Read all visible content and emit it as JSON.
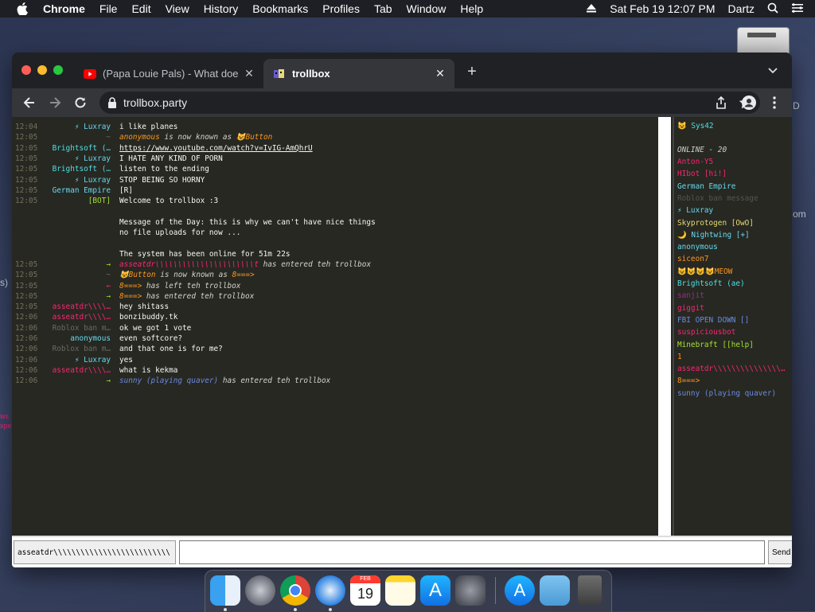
{
  "menubar": {
    "app": "Chrome",
    "items": [
      "File",
      "Edit",
      "View",
      "History",
      "Bookmarks",
      "Profiles",
      "Tab",
      "Window",
      "Help"
    ],
    "datetime": "Sat Feb 19  12:07 PM",
    "user": "Dartz"
  },
  "desktop": {
    "fragments": [
      "D",
      "om",
      "s)",
      "ws",
      "xpe"
    ]
  },
  "browser": {
    "tabs": [
      {
        "title": "(Papa Louie Pals) - What does",
        "icon": "youtube-icon"
      },
      {
        "title": "trollbox",
        "icon": "trollbox-icon"
      }
    ],
    "url": "trollbox.party"
  },
  "colors": {
    "bg": "#272822",
    "time": "#75715e",
    "blue": "#66d9ef",
    "cyan": "#4fdfe3",
    "orange": "#fd971f",
    "red": "#f92672",
    "green": "#a6e22e",
    "yellow": "#e6db74",
    "lightblue": "#6b8ae0"
  },
  "chat": [
    {
      "t": "12:04",
      "n": "⚡ Luxray",
      "nc": "#66d9ef",
      "m": "i like planes"
    },
    {
      "t": "12:05",
      "n": "~",
      "nc": "#75715e",
      "m": "anonymous",
      "mc": "#fd971f",
      "s": " is now known as ",
      "m2": "😺Button",
      "m2c": "#fd971f"
    },
    {
      "t": "12:05",
      "n": "Brightsoft (…",
      "nc": "#4fdfe3",
      "m": "https://www.youtube.com/watch?v=IvIG-AmQhrU",
      "u": true
    },
    {
      "t": "12:05",
      "n": "⚡ Luxray",
      "nc": "#66d9ef",
      "m": "I HATE ANY KIND OF PORN"
    },
    {
      "t": "12:05",
      "n": "Brightsoft (…",
      "nc": "#4fdfe3",
      "m": "listen to the ending"
    },
    {
      "t": "12:05",
      "n": "⚡ Luxray",
      "nc": "#66d9ef",
      "m": "STOP BEING SO HORNY"
    },
    {
      "t": "12:05",
      "n": "German Empire",
      "nc": "#66d9ef",
      "m": "[R]"
    },
    {
      "t": "12:05",
      "n": "[BOT]",
      "nc": "#a6e22e",
      "m": "Welcome to trollbox :3"
    },
    {
      "t": "",
      "n": "",
      "nc": "#fff",
      "m": ""
    },
    {
      "t": "",
      "n": "",
      "nc": "#fff",
      "m": "Message of the Day: this is why we can't have nice things"
    },
    {
      "t": "",
      "n": "",
      "nc": "#fff",
      "m": "no file uploads for now ..."
    },
    {
      "t": "",
      "n": "",
      "nc": "#fff",
      "m": ""
    },
    {
      "t": "",
      "n": "",
      "nc": "#fff",
      "m": "The system has been online for 51m 22s"
    },
    {
      "t": "12:05",
      "n": "→",
      "nc": "#a6e22e",
      "m": "asseatdr\\\\\\\\\\\\\\\\\\\\\\\\\\\\\\\\\\\\\\\\\\\\t",
      "mc": "#f92672",
      "s": " has entered teh trollbox"
    },
    {
      "t": "12:05",
      "n": "~",
      "nc": "#75715e",
      "m": "😺Button",
      "mc": "#fd971f",
      "s": " is now known as ",
      "m2": "8===>",
      "m2c": "#fd971f"
    },
    {
      "t": "12:05",
      "n": "←",
      "nc": "#f92672",
      "m": "8===>",
      "mc": "#fd971f",
      "s": " has left teh trollbox"
    },
    {
      "t": "12:05",
      "n": "→",
      "nc": "#a6e22e",
      "m": "8===>",
      "mc": "#fd971f",
      "s": " has entered teh trollbox"
    },
    {
      "t": "12:05",
      "n": "asseatdr\\\\\\\\…",
      "nc": "#f92672",
      "m": "hey shitass"
    },
    {
      "t": "12:06",
      "n": "asseatdr\\\\\\\\…",
      "nc": "#f92672",
      "m": "bonzibuddy.tk"
    },
    {
      "t": "12:06",
      "n": "Roblox ban m…",
      "nc": "#6a6a66",
      "m": "ok we got 1 vote"
    },
    {
      "t": "12:06",
      "n": "anonymous",
      "nc": "#66d9ef",
      "m": "even softcore?"
    },
    {
      "t": "12:06",
      "n": "Roblox ban m…",
      "nc": "#6a6a66",
      "m": "and that one is for me?"
    },
    {
      "t": "12:06",
      "n": "⚡ Luxray",
      "nc": "#66d9ef",
      "m": "yes"
    },
    {
      "t": "12:06",
      "n": "asseatdr\\\\\\\\…",
      "nc": "#f92672",
      "m": "what is kekma"
    },
    {
      "t": "12:06",
      "n": "→",
      "nc": "#a6e22e",
      "m": "sunny (playing quaver)",
      "mc": "#6b8ae0",
      "s": " has entered teh trollbox"
    }
  ],
  "userlist": {
    "me": "😺 Sys42",
    "online_label": "ONLINE - 20",
    "users": [
      {
        "name": "Anton-Y5",
        "c": "#f92672"
      },
      {
        "name": "HIbot [hi!]",
        "c": "#f92672"
      },
      {
        "name": "German Empire",
        "c": "#66d9ef"
      },
      {
        "name": "Roblox ban message",
        "c": "#555550"
      },
      {
        "name": "⚡ Luxray",
        "c": "#66d9ef"
      },
      {
        "name": "Skyprotogen [OwO]",
        "c": "#e6db74"
      },
      {
        "name": "🌙 Nightwing [+]",
        "c": "#66d9ef"
      },
      {
        "name": "anonymous",
        "c": "#66d9ef"
      },
      {
        "name": "siceon7",
        "c": "#fd971f"
      },
      {
        "name": "😺😺😺😺MEOW",
        "c": "#fd971f"
      },
      {
        "name": "Brightsoft (ae)",
        "c": "#4fdfe3"
      },
      {
        "name": "sanjit",
        "c": "#9c2a8c"
      },
      {
        "name": "giggit",
        "c": "#f92672"
      },
      {
        "name": "FBI OPEN DOWN []",
        "c": "#6b8ae0"
      },
      {
        "name": "suspiciousbot",
        "c": "#f92672"
      },
      {
        "name": "Minebraft [[help]",
        "c": "#a6e22e"
      },
      {
        "name": "1",
        "c": "#fd971f"
      },
      {
        "name": "asseatdr\\\\\\\\\\\\\\\\\\\\\\\\\\\\\\\\\\\\\\\\",
        "c": "#f92672"
      },
      {
        "name": "8===>",
        "c": "#fd971f"
      },
      {
        "name": "sunny (playing quaver)",
        "c": "#6b8ae0"
      }
    ]
  },
  "input": {
    "nick": "asseatdr\\\\\\\\\\\\\\\\\\\\\\\\\\\\\\\\\\\\\\\\\\\\\\\\\\\\",
    "message_value": "",
    "send_label": "Send"
  },
  "dock": {
    "apps": [
      "finder-icon",
      "launchpad-icon",
      "chrome-icon",
      "safari-icon",
      "calendar-icon",
      "notes-icon",
      "app-store-icon",
      "system-preferences-icon",
      "app-store-icon",
      "downloads-folder-icon",
      "trash-icon"
    ],
    "calendar": {
      "month": "FEB",
      "day": "19"
    }
  }
}
